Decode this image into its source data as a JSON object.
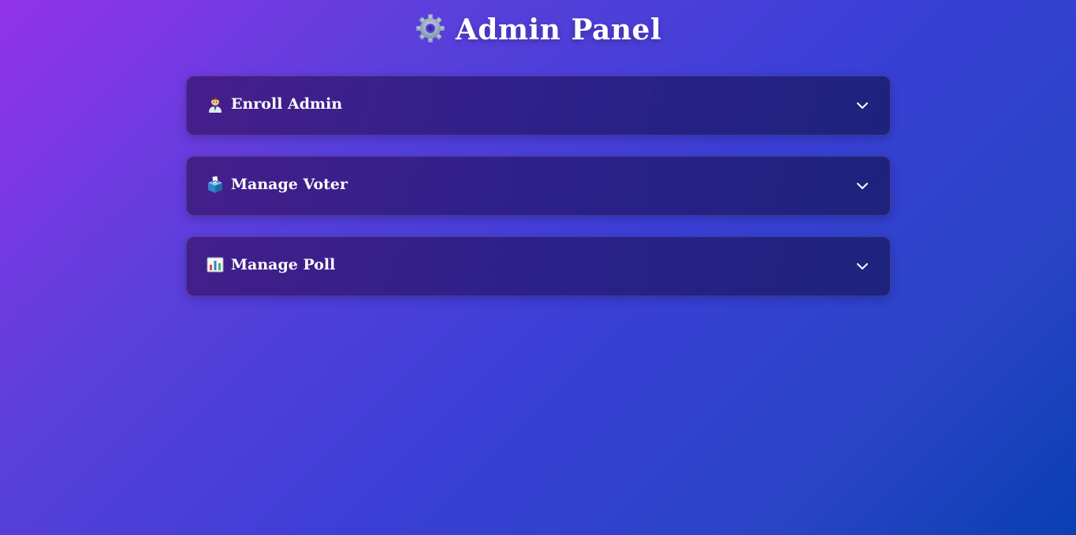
{
  "header": {
    "title": "Admin Panel",
    "icon": "gear-icon"
  },
  "panels": [
    {
      "label": "Enroll Admin",
      "icon": "office-worker-icon",
      "expanded": false
    },
    {
      "label": "Manage Voter",
      "icon": "ballot-box-icon",
      "expanded": false
    },
    {
      "label": "Manage Poll",
      "icon": "bar-chart-icon",
      "expanded": false
    }
  ],
  "colors": {
    "gradient_start": "#9333ea",
    "gradient_end": "#0a3fb2",
    "panel_background": "#2a1a78",
    "text": "#ffffff"
  }
}
